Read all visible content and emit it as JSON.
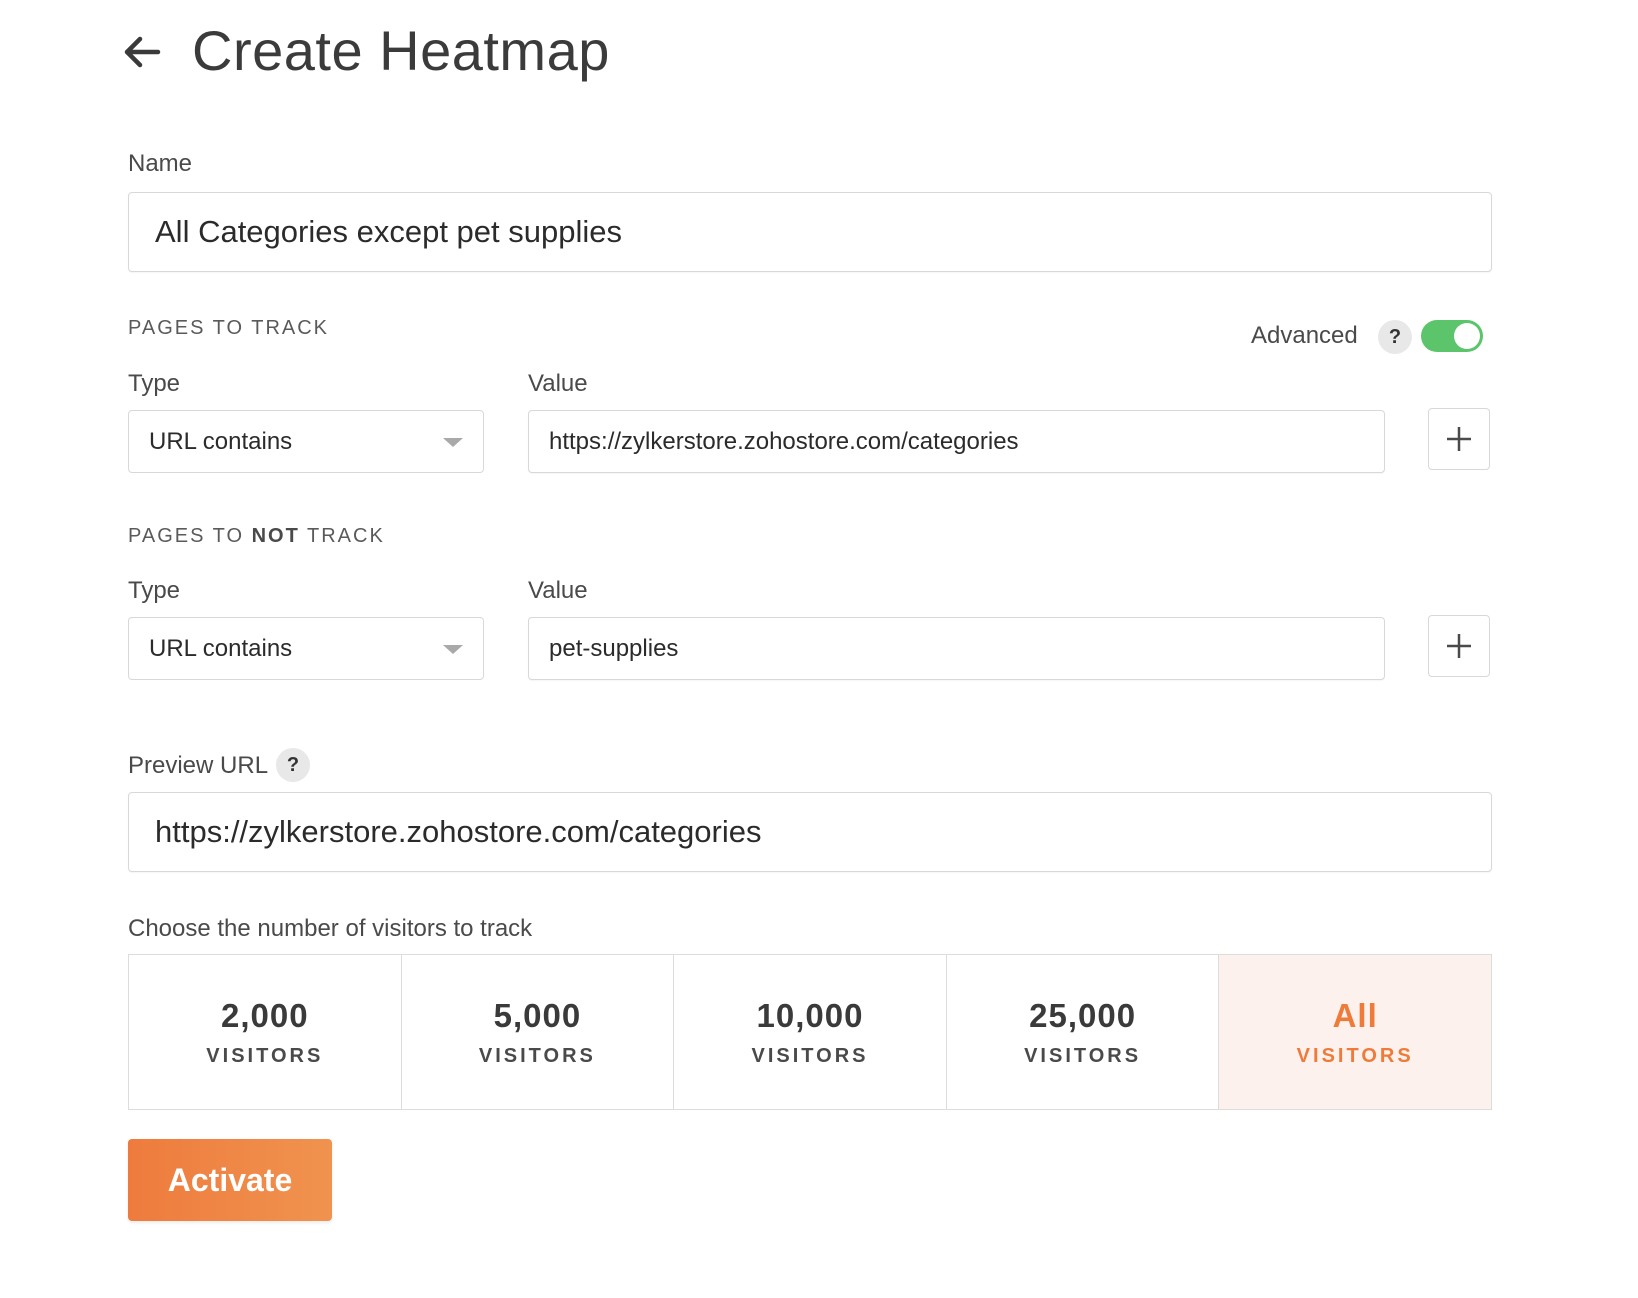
{
  "header": {
    "title": "Create Heatmap"
  },
  "name_field": {
    "label": "Name",
    "value": "All Categories except pet supplies"
  },
  "pages_to_track": {
    "heading": "PAGES TO TRACK",
    "advanced_label": "Advanced",
    "advanced_enabled": true,
    "help": "?",
    "type_label": "Type",
    "value_label": "Value",
    "type_value": "URL contains",
    "value_value": "https://zylkerstore.zohostore.com/categories",
    "add": "+"
  },
  "pages_to_not_track": {
    "heading_prefix": "PAGES TO ",
    "heading_bold": "NOT",
    "heading_suffix": " TRACK",
    "type_label": "Type",
    "value_label": "Value",
    "type_value": "URL contains",
    "value_value": "pet-supplies",
    "add": "+"
  },
  "preview": {
    "label": "Preview URL",
    "help": "?",
    "value": "https://zylkerstore.zohostore.com/categories"
  },
  "visitors": {
    "label": "Choose the number of visitors to track",
    "options": [
      {
        "count": "2,000",
        "unit": "VISITORS",
        "selected": false
      },
      {
        "count": "5,000",
        "unit": "VISITORS",
        "selected": false
      },
      {
        "count": "10,000",
        "unit": "VISITORS",
        "selected": false
      },
      {
        "count": "25,000",
        "unit": "VISITORS",
        "selected": false
      },
      {
        "count": "All",
        "unit": "VISITORS",
        "selected": true
      }
    ]
  },
  "actions": {
    "activate": "Activate"
  },
  "colors": {
    "accent": "#ef7b3a",
    "toggle_on": "#5cc46b",
    "selected_bg": "#fcf1ec"
  }
}
